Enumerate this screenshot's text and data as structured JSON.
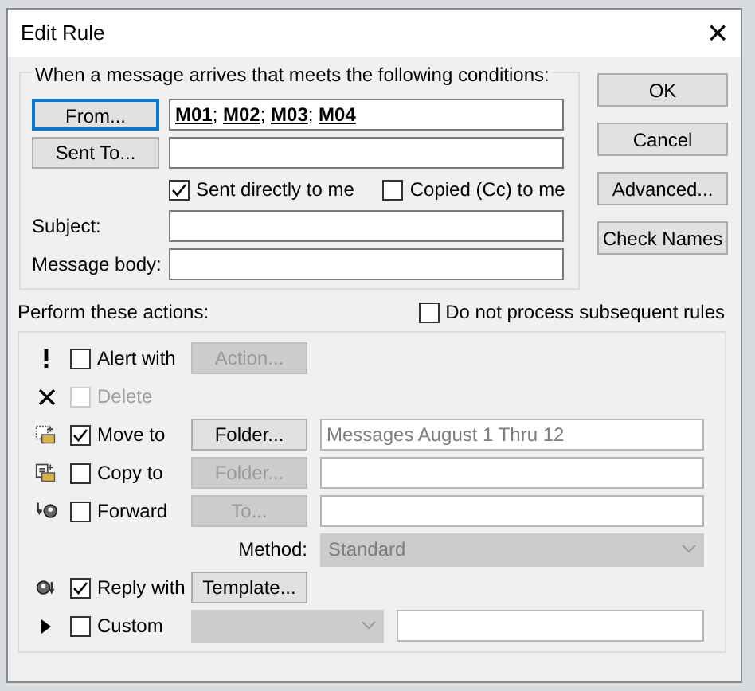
{
  "window": {
    "title": "Edit Rule",
    "close": "×"
  },
  "conditions": {
    "caption": "When a message arrives that meets the following conditions:",
    "from": {
      "button": "From...",
      "focused": true,
      "recipients": [
        "M01",
        "M02",
        "M03",
        "M04"
      ],
      "separator": ";"
    },
    "sent_to": {
      "button": "Sent To..."
    },
    "checks": [
      {
        "label": "Sent directly to me",
        "checked": true
      },
      {
        "label": "Copied (Cc) to me",
        "checked": false
      }
    ],
    "fields": [
      {
        "label": "Subject:"
      },
      {
        "label": "Message body:"
      }
    ]
  },
  "buttons": [
    "OK",
    "Cancel",
    "Advanced...",
    "Check Names"
  ],
  "actions_caption": "Perform these actions:",
  "stop_rule": {
    "label": "Do not process subsequent rules",
    "checked": false
  },
  "actions": [
    {
      "kind": "alert",
      "label": "Alert with",
      "checked": false,
      "disabled": false,
      "button": {
        "label": "Action...",
        "disabled": true
      }
    },
    {
      "kind": "delete",
      "label": "Delete",
      "checked": false,
      "disabled": true
    },
    {
      "kind": "move",
      "label": "Move to",
      "checked": true,
      "disabled": false,
      "button": {
        "label": "Folder...",
        "disabled": false
      },
      "field": {
        "value": "Messages August 1 Thru 12",
        "disabled": true
      }
    },
    {
      "kind": "copy",
      "label": "Copy to",
      "checked": false,
      "disabled": false,
      "button": {
        "label": "Folder...",
        "disabled": true
      },
      "field": {
        "disabled": true
      }
    },
    {
      "kind": "forward",
      "label": "Forward",
      "checked": false,
      "disabled": false,
      "button": {
        "label": "To...",
        "disabled": true
      },
      "field": {
        "disabled": true
      }
    },
    {
      "kind": "method",
      "label": "Method:",
      "select": {
        "value": "Standard",
        "disabled": true
      }
    },
    {
      "kind": "reply",
      "label": "Reply with",
      "checked": true,
      "disabled": false,
      "button": {
        "label": "Template...",
        "disabled": false
      }
    },
    {
      "kind": "custom",
      "label": "Custom",
      "checked": false,
      "disabled": false,
      "select": {
        "disabled": true
      },
      "field": {
        "disabled": true
      }
    }
  ]
}
